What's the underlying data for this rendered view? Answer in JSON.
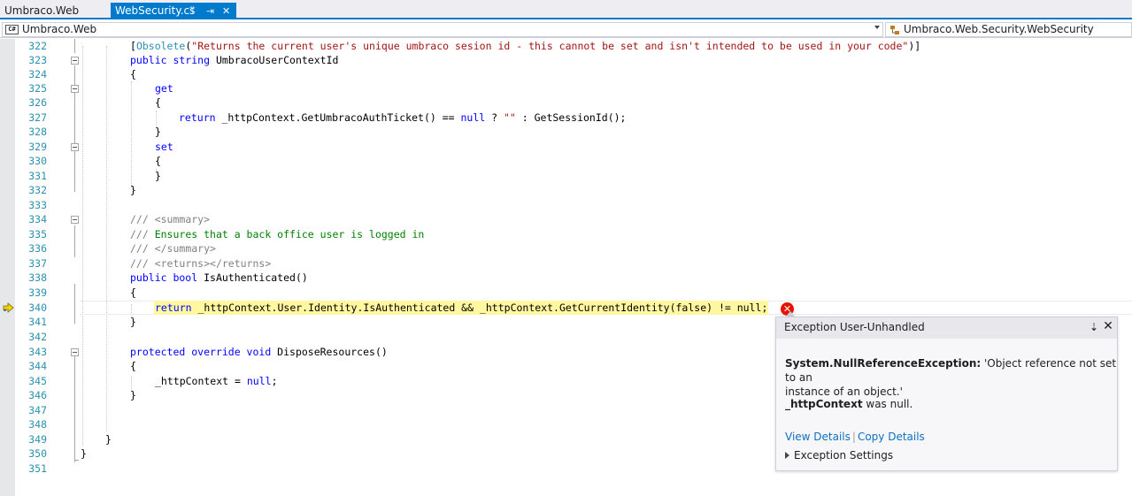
{
  "tabs": [
    {
      "label": "Umbraco.Web",
      "active": false
    },
    {
      "label": "WebSecurity.cs",
      "active": true,
      "pin_glyph": "⍡",
      "float_glyph": "⇥",
      "close_glyph": "✕"
    }
  ],
  "navbar": {
    "project": "Umbraco.Web",
    "project_icon_text": "C#",
    "type": "Umbraco.Web.Security.WebSecurity"
  },
  "colors": {
    "accent": "#007acc",
    "keyword": "#0000ff",
    "string": "#a31515",
    "comment": "#008000",
    "type": "#2b91af",
    "highlight": "#fff8a0",
    "error": "#e51400",
    "link": "#0e70c0"
  },
  "code": {
    "line_numbers": [
      "322",
      "323",
      "324",
      "325",
      "326",
      "327",
      "328",
      "329",
      "330",
      "331",
      "332",
      "333",
      "334",
      "335",
      "336",
      "337",
      "338",
      "339",
      "340",
      "341",
      "342",
      "343",
      "344",
      "345",
      "346",
      "347",
      "348",
      "349",
      "350",
      "351"
    ],
    "l322_open": "[",
    "l322_attr": "Obsolete",
    "l322_paren": "(",
    "l322_str": "\"Returns the current user's unique umbraco sesion id - this cannot be set and isn't intended to be used in your code\"",
    "l322_close": ")]",
    "l323_kw": "public string",
    "l323_rest": " UmbracoUserContextId",
    "brace_open": "{",
    "brace_close": "}",
    "get_kw": "get",
    "set_kw": "set",
    "return_kw": "return",
    "l327_mid": " _httpContext.GetUmbracoAuthTicket() == ",
    "null_kw": "null",
    "l327_q": " ? ",
    "l327_str": "\"\"",
    "l327_end": " : GetSessionId();",
    "xml_slashes": "///",
    "l334_tag": " <summary>",
    "l335_text": " Ensures that a back office user is logged in",
    "l336_tag": " </summary>",
    "l337_tag": " <returns></returns>",
    "l338_kw": "public bool",
    "l338_rest": " IsAuthenticated()",
    "l340_text": " _httpContext.User.Identity.IsAuthenticated && _httpContext.GetCurrentIdentity(false) != null;",
    "l343_kw": "protected override void",
    "l343_rest": " DisposeResources()",
    "l345_a": "_httpContext = ",
    "l345_b": ";"
  },
  "exception": {
    "title": "Exception User-Unhandled",
    "pin_icon": "⇣",
    "close_icon": "✕",
    "error_icon": "✕",
    "type_name": "System.NullReferenceException:",
    "message_a": " 'Object reference not set to an",
    "message_b": "instance of an object.'",
    "var_name": "_httpContext",
    "var_rest": " was null.",
    "view_details": "View Details",
    "link_separator": "|",
    "copy_details": "Copy Details",
    "settings_label": "Exception Settings"
  }
}
